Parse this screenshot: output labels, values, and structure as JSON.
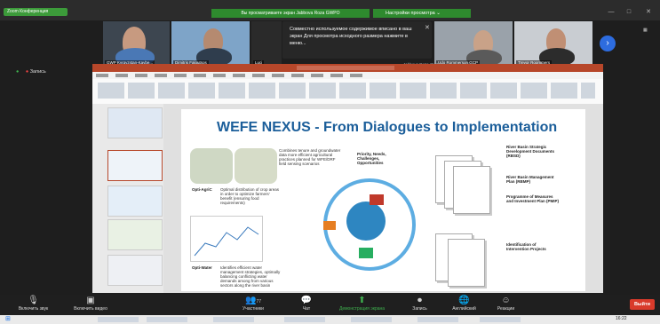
{
  "topbar": {
    "meeting_label": "Zoom Конференция",
    "share_banner": "Вы просматриваете экран Jabbova Roza GWPO",
    "view_options": "Настройки просмотра",
    "window_buttons": [
      "—",
      "□",
      "✕"
    ]
  },
  "participants": [
    {
      "name": "GWP Kyrgyzstan-Kaybe..."
    },
    {
      "name": "Dimitris Faloutsos"
    },
    {
      "name": "Luci"
    },
    {
      "name": "Jabbova Roza GWPO"
    },
    {
      "name": "Udo Rommerson GCP"
    },
    {
      "name": "Trevor Roommers"
    }
  ],
  "notice_text": "Совместно используемое содержимое вписано в ваш экран Для просмотра исходного размера нажмите в меню...",
  "left_panel": {
    "record_label": "Запись"
  },
  "slide": {
    "title": "WEFE NEXUS - From Dialogues to Implementation",
    "center_label": "Priority, Needs, Challenges, Opportunities",
    "note_top": "Combines tenure and groundwater data more efficient agricultural practices planned for WFE/DRF field sensing scenarios",
    "label_left1": "Opti-AgriC",
    "desc_left1": "Optimal distribution of crop areas in order to optimize farmers' benefit (ensuring food requirements)",
    "label_left2": "Opti-Water",
    "desc_left2": "Identifies efficient water management strategies, optimally balancing conflicting water demands among from various sectors along the river basin",
    "right_items": [
      "River Basin Strategic Development Documents (RBSD)",
      "River Basin Management Plan (RBMP)",
      "Programme of Measures and Investment Plan (PMIP)",
      "Identification of Intervention Projects"
    ]
  },
  "toolbar": {
    "mute": "Включить звук",
    "video": "Включить видео",
    "participants": "Участники",
    "participant_count": "77",
    "chat": "Чат",
    "share": "Демонстрация экрана",
    "record": "Запись",
    "language": "Английский",
    "reactions": "Реакции",
    "end": "Выйти"
  },
  "taskbar": {
    "time": "16:22"
  },
  "colors": {
    "zoom_green": "#2e8a2e",
    "zoom_blue": "#2d6cdf",
    "end_red": "#d93b2b",
    "ppt_red": "#b7472a",
    "title_blue": "#1b5e9a"
  }
}
